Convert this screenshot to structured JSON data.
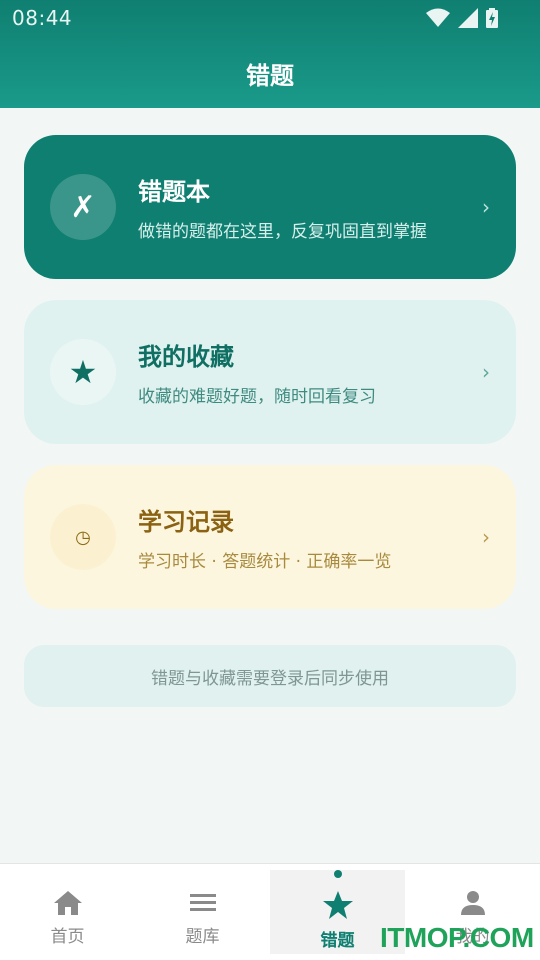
{
  "status_bar": {
    "time": "08:44"
  },
  "header": {
    "title": "错题"
  },
  "cards": [
    {
      "title": "错题本",
      "subtitle": "做错的题都在这里，反复巩固直到掌握",
      "icon": "cross-icon",
      "glyph": "✗",
      "chevron": "›"
    },
    {
      "title": "我的收藏",
      "subtitle": "收藏的难题好题，随时回看复习",
      "icon": "star-icon",
      "glyph": "★",
      "chevron": "›"
    },
    {
      "title": "学习记录",
      "subtitle": "学习时长 · 答题统计 · 正确率一览",
      "icon": "clock-icon",
      "glyph": "◷",
      "chevron": "›"
    }
  ],
  "notice": "错题与收藏需要登录后同步使用",
  "bottom_nav": [
    {
      "label": "首页",
      "icon": "home-icon",
      "active": false
    },
    {
      "label": "题库",
      "icon": "menu-icon",
      "active": false
    },
    {
      "label": "错题",
      "icon": "star-icon",
      "active": true
    },
    {
      "label": "我的",
      "icon": "person-icon",
      "active": false
    }
  ],
  "watermark": "ITMOP.COM",
  "colors": {
    "primary": "#0f7f71",
    "background": "#f2f7f6"
  }
}
